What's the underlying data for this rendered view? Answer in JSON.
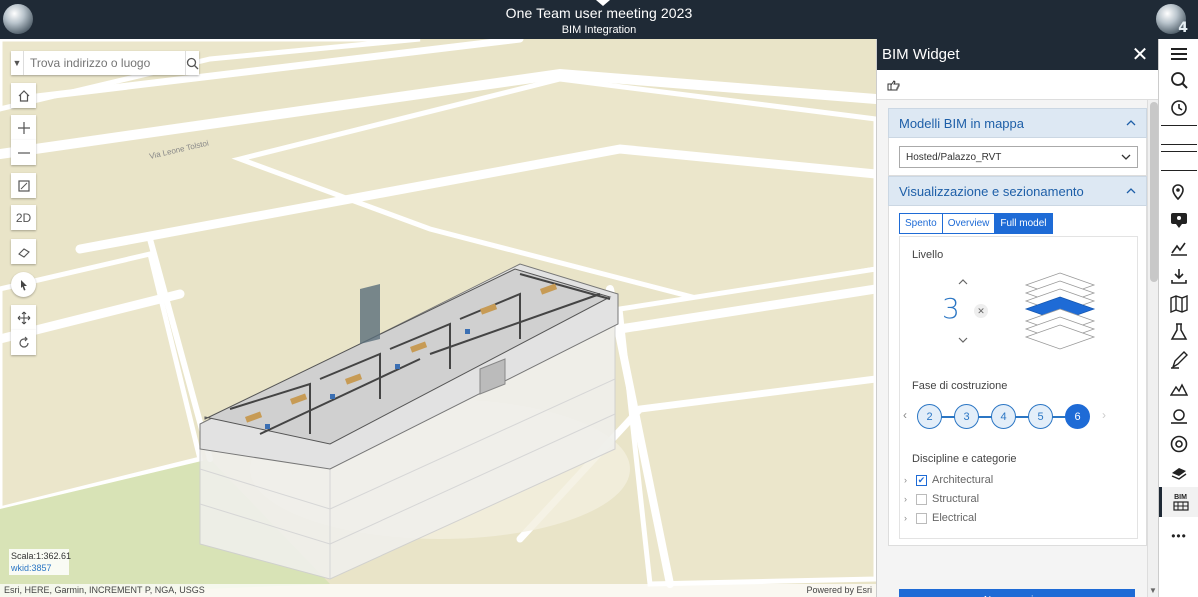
{
  "header": {
    "title": "One Team user meeting 2023",
    "subtitle": "BIM Integration",
    "badge": "4"
  },
  "map": {
    "search": {
      "placeholder": "Trova indirizzo o luogo"
    },
    "tools": {
      "view_2d": "2D"
    },
    "scale": {
      "label": "Scala:1:362.61",
      "wkid": "wkid:3857"
    },
    "attribution": "Esri, HERE, Garmin, INCREMENT P, NGA, USGS",
    "powered_by": "Powered by Esri",
    "street_label": "Via Leone Tolstoi"
  },
  "panel": {
    "title": "BIM Widget",
    "sections": {
      "models": {
        "title": "Modelli BIM in mappa",
        "selected_model": "Hosted/Palazzo_RVT"
      },
      "visualization": {
        "title": "Visualizzazione e sezionamento",
        "modes": [
          "Spento",
          "Overview",
          "Full model"
        ],
        "active_mode": "Full model",
        "level_label": "Livello",
        "level_value": "3",
        "phase_label": "Fase di costruzione",
        "phases": [
          "2",
          "3",
          "4",
          "5",
          "6"
        ],
        "selected_phase": "6",
        "disciplines_label": "Discipline e categorie",
        "disciplines": [
          {
            "label": "Architectural",
            "checked": true
          },
          {
            "label": "Structural",
            "checked": false
          },
          {
            "label": "Electrical",
            "checked": false
          }
        ],
        "new_section_button": "Nuova sezione"
      }
    }
  },
  "rail": {
    "bim_label": "BIM",
    "more": "•••"
  },
  "colors": {
    "header_bg": "#1f2a36",
    "accent": "#1e6bd6",
    "section_header": "#dde8f3",
    "map_bg": "#e9e4c8"
  }
}
